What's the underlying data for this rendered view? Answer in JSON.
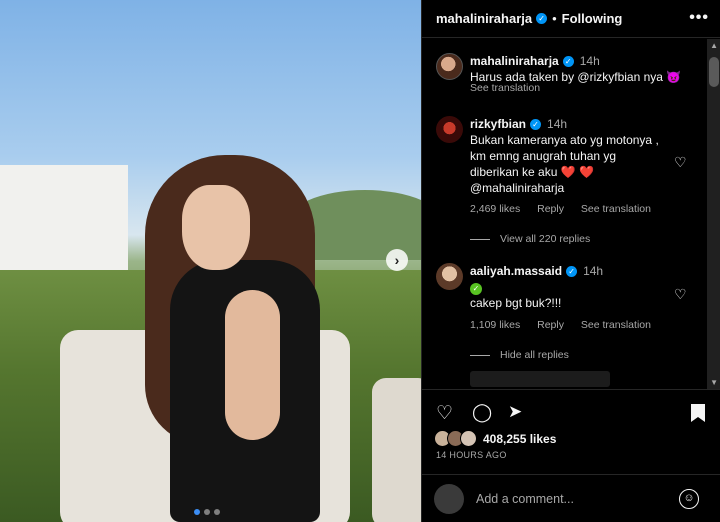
{
  "header": {
    "username": "mahaliniraharja",
    "separator": "•",
    "follow_status": "Following",
    "more_icon": "more-horizontal-icon"
  },
  "comments": [
    {
      "username": "mahaliniraharja",
      "time": "14h",
      "text": "Harus ada taken by @rizkyfbian nya",
      "emoji": "😈",
      "see_translation": "See translation"
    },
    {
      "username": "rizkyfbian",
      "time": "14h",
      "lines": [
        "Bukan kameranya ato yg motonya ,",
        "km emng anugrah tuhan yg",
        "diberikan ke aku",
        "@mahaliniraharja"
      ],
      "emoji": "❤️ ❤️",
      "likes": "2,469 likes",
      "reply": "Reply",
      "see_translation": "See translation",
      "view_replies": "View all 220 replies"
    },
    {
      "username": "aaliyah.massaid",
      "time": "14h",
      "badge": "✓",
      "text": "cakep bgt buk?!!!",
      "likes": "1,109 likes",
      "reply": "Reply",
      "see_translation": "See translation",
      "hide_replies": "Hide all replies"
    }
  ],
  "post": {
    "likes": "408,255 likes",
    "time_ago": "14 HOURS AGO",
    "add_comment_placeholder": "Add a comment..."
  },
  "carousel": {
    "next_glyph": "›",
    "current_index": 1,
    "total": 3
  }
}
